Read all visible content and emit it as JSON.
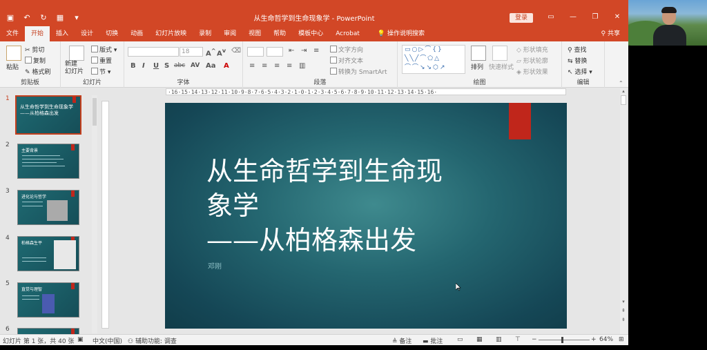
{
  "window": {
    "title": "从生命哲学到生命现象学  -  PowerPoint",
    "login_label": "登录",
    "controls": [
      "▭",
      "—",
      "❐",
      "✕"
    ]
  },
  "qat_icons": [
    "save-icon",
    "undo-icon",
    "redo-icon",
    "present-icon",
    "customize-icon"
  ],
  "tabs": [
    {
      "label": "文件",
      "active": false
    },
    {
      "label": "开始",
      "active": true
    },
    {
      "label": "插入",
      "active": false
    },
    {
      "label": "设计",
      "active": false
    },
    {
      "label": "切换",
      "active": false
    },
    {
      "label": "动画",
      "active": false
    },
    {
      "label": "幻灯片放映",
      "active": false
    },
    {
      "label": "录制",
      "active": false
    },
    {
      "label": "审阅",
      "active": false
    },
    {
      "label": "视图",
      "active": false
    },
    {
      "label": "帮助",
      "active": false
    },
    {
      "label": "模板中心",
      "active": false
    },
    {
      "label": "Acrobat",
      "active": false
    }
  ],
  "tell_me": "操作说明搜索",
  "share": "共享",
  "ribbon": {
    "clipboard": {
      "paste": "粘贴",
      "cut": "剪切",
      "copy": "复制",
      "format_painter": "格式刷",
      "label": "剪贴板"
    },
    "slides": {
      "new_slide": "新建\n幻灯片",
      "layout": "版式",
      "reset": "重置",
      "section": "节",
      "label": "幻灯片"
    },
    "font": {
      "size": "18",
      "label": "字体",
      "bold": "B",
      "italic": "I",
      "underline": "U",
      "strike": "S",
      "spacing": "abc",
      "case": "AV"
    },
    "paragraph": {
      "text_direction": "文字方向",
      "align_text": "对齐文本",
      "smartart": "转换为 SmartArt",
      "label": "段落"
    },
    "drawing": {
      "arrange": "排列",
      "quick_styles": "快速样式",
      "fill": "形状填充",
      "outline": "形状轮廓",
      "effects": "形状效果",
      "label": "绘图"
    },
    "editing": {
      "find": "查找",
      "replace": "替换",
      "select": "选择",
      "label": "编辑"
    }
  },
  "thumbnails": [
    {
      "num": "1",
      "text": "从生命哲学到生命现象学\n——从柏格森出发"
    },
    {
      "num": "2",
      "text": "主要背景"
    },
    {
      "num": "3",
      "text": "进化论与哲学"
    },
    {
      "num": "4",
      "text": "柏格森生平"
    },
    {
      "num": "5",
      "text": "直觉与理智"
    },
    {
      "num": "6",
      "text": ""
    }
  ],
  "ruler_text": "·16·15·14·13·12·11·10·9·8·7·6·5·4·3·2·1·0·1·2·3·4·5·6·7·8·9·10·11·12·13·14·15·16·",
  "slide": {
    "title": "从生命哲学到生命现\n象学\n——从柏格森出发",
    "author": "邓刚"
  },
  "status": {
    "slide_info": "幻灯片 第 1 张，共 40 张",
    "language": "中文(中国)",
    "accessibility": "辅助功能: 调查",
    "notes": "备注",
    "comments": "批注",
    "zoom": "64%"
  }
}
